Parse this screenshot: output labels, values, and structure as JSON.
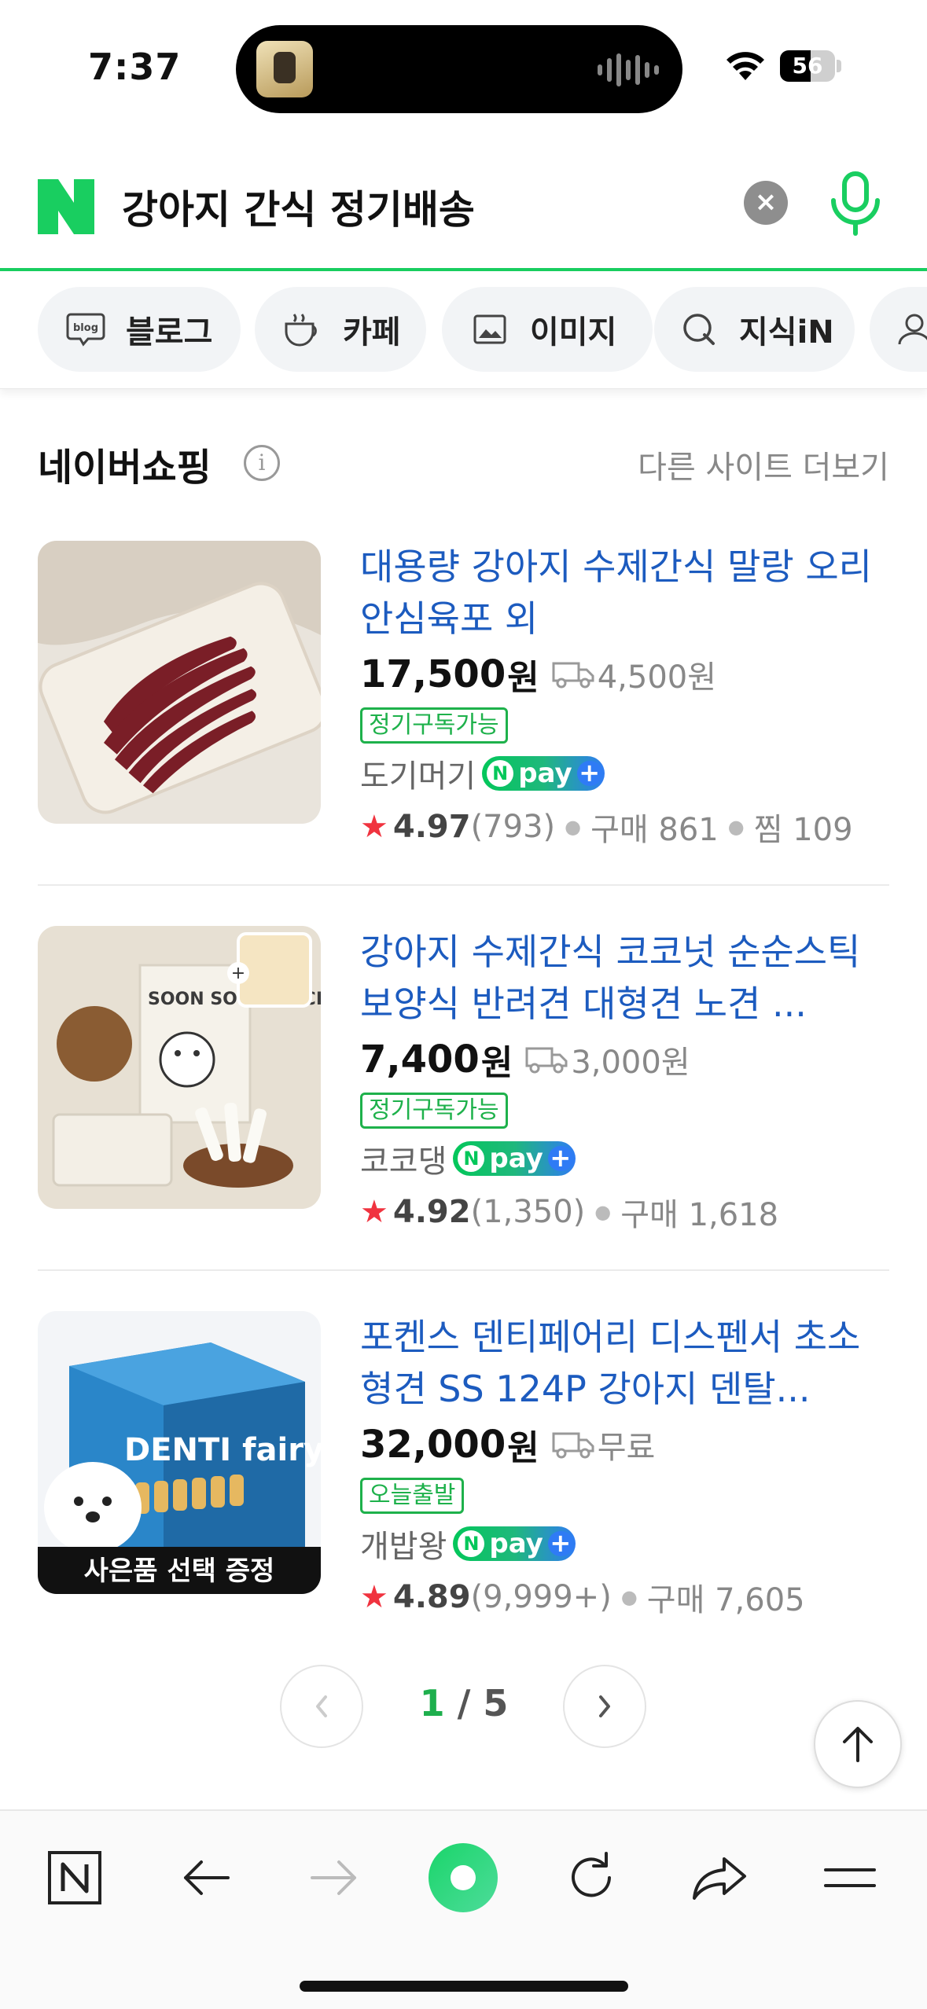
{
  "status_bar": {
    "time": "7:37",
    "battery_level": "56",
    "battery_fraction": 0.56
  },
  "search": {
    "logo": "N",
    "query": "강아지 간식 정기배송",
    "clear_icon": "close-circle-icon",
    "mic_icon": "microphone-icon"
  },
  "tabs": [
    {
      "label": "블로그",
      "icon": "blog-icon"
    },
    {
      "label": "카페",
      "icon": "cafe-cup-icon"
    },
    {
      "label": "이미지",
      "icon": "image-icon"
    },
    {
      "label": "지식iN",
      "icon": "knowledge-q-icon"
    }
  ],
  "section": {
    "title": "네이버쇼핑",
    "more_label": "다른 사이트 더보기"
  },
  "products": [
    {
      "title": "대용량 강아지 수제간식 말랑 오리안심육포 외",
      "price": "17,500",
      "won": "원",
      "shipping": "4,500원",
      "tag": "정기구독가능",
      "seller": "도기머기",
      "npay": "pay",
      "rating": "4.97",
      "reviews": "(793)",
      "purchases": "구매 861",
      "wishes": "찜 109"
    },
    {
      "title": "강아지 수제간식 코코넛 순순스틱 보양식 반려견 대형견 노견 ...",
      "price": "7,400",
      "won": "원",
      "shipping": "3,000원",
      "tag": "정기구독가능",
      "seller": "코코댕",
      "npay": "pay",
      "rating": "4.92",
      "reviews": "(1,350)",
      "purchases": "구매 1,618",
      "wishes": "",
      "thumb_text": "SOON SOON STICK"
    },
    {
      "title": "포켄스 덴티페어리 디스펜서 초소형견 SS 124P 강아지 덴탈...",
      "price": "32,000",
      "won": "원",
      "shipping": "무료",
      "tag": "오늘출발",
      "seller": "개밥왕",
      "npay": "pay",
      "rating": "4.89",
      "reviews": "(9,999+)",
      "purchases": "구매 7,605",
      "wishes": "",
      "thumb_text": "DENTI fairy",
      "thumb_banner": "사은품 선택 증정"
    }
  ],
  "pager": {
    "current": "1",
    "separator": " / ",
    "total": "5"
  },
  "toolbar": {
    "icons": [
      "naver-home-icon",
      "back-arrow-icon",
      "forward-arrow-icon",
      "green-dot-icon",
      "refresh-icon",
      "share-icon",
      "menu-icon"
    ]
  },
  "colors": {
    "brand_green": "#19ce60",
    "link_blue": "#1c5bbf",
    "star_red": "#f0333f"
  }
}
